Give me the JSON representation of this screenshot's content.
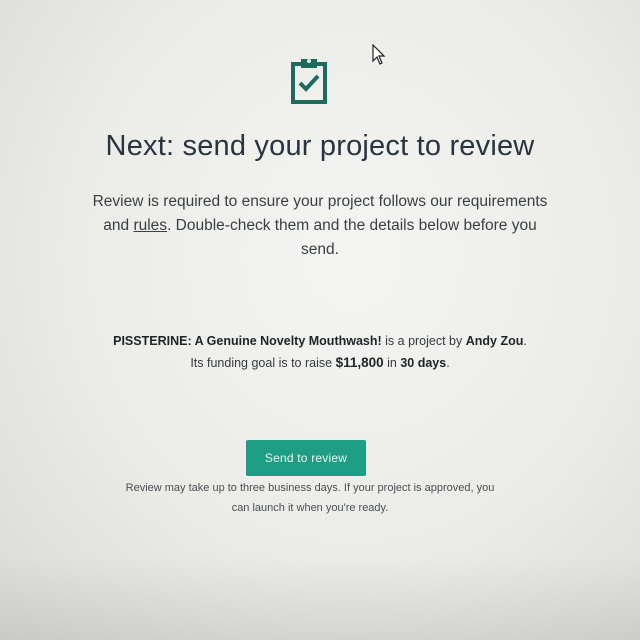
{
  "header": {
    "icon": "clipboard-check-icon",
    "title": "Next: send your project to review"
  },
  "intro": {
    "text_before_link": "Review is required to ensure your project follows our requirements and ",
    "rules_link": "rules",
    "text_after_link": ". Double-check them and the details below before you send."
  },
  "summary": {
    "project_name": "PISSTERINE: A Genuine Novelty Mouthwash!",
    "is_project_by": " is a project by ",
    "creator": "Andy Zou",
    "funding_text": ". Its funding goal is to raise ",
    "goal_amount": "$11,800",
    "in_text": " in ",
    "duration": "30 days",
    "end_period": "."
  },
  "actions": {
    "send_label": "Send to review"
  },
  "note": {
    "text": "Review may take up to three business days. If your project is approved, you can launch it when you're ready."
  },
  "colors": {
    "accent": "#1f9e86",
    "icon": "#1d6a5e",
    "text": "#2b3136"
  }
}
